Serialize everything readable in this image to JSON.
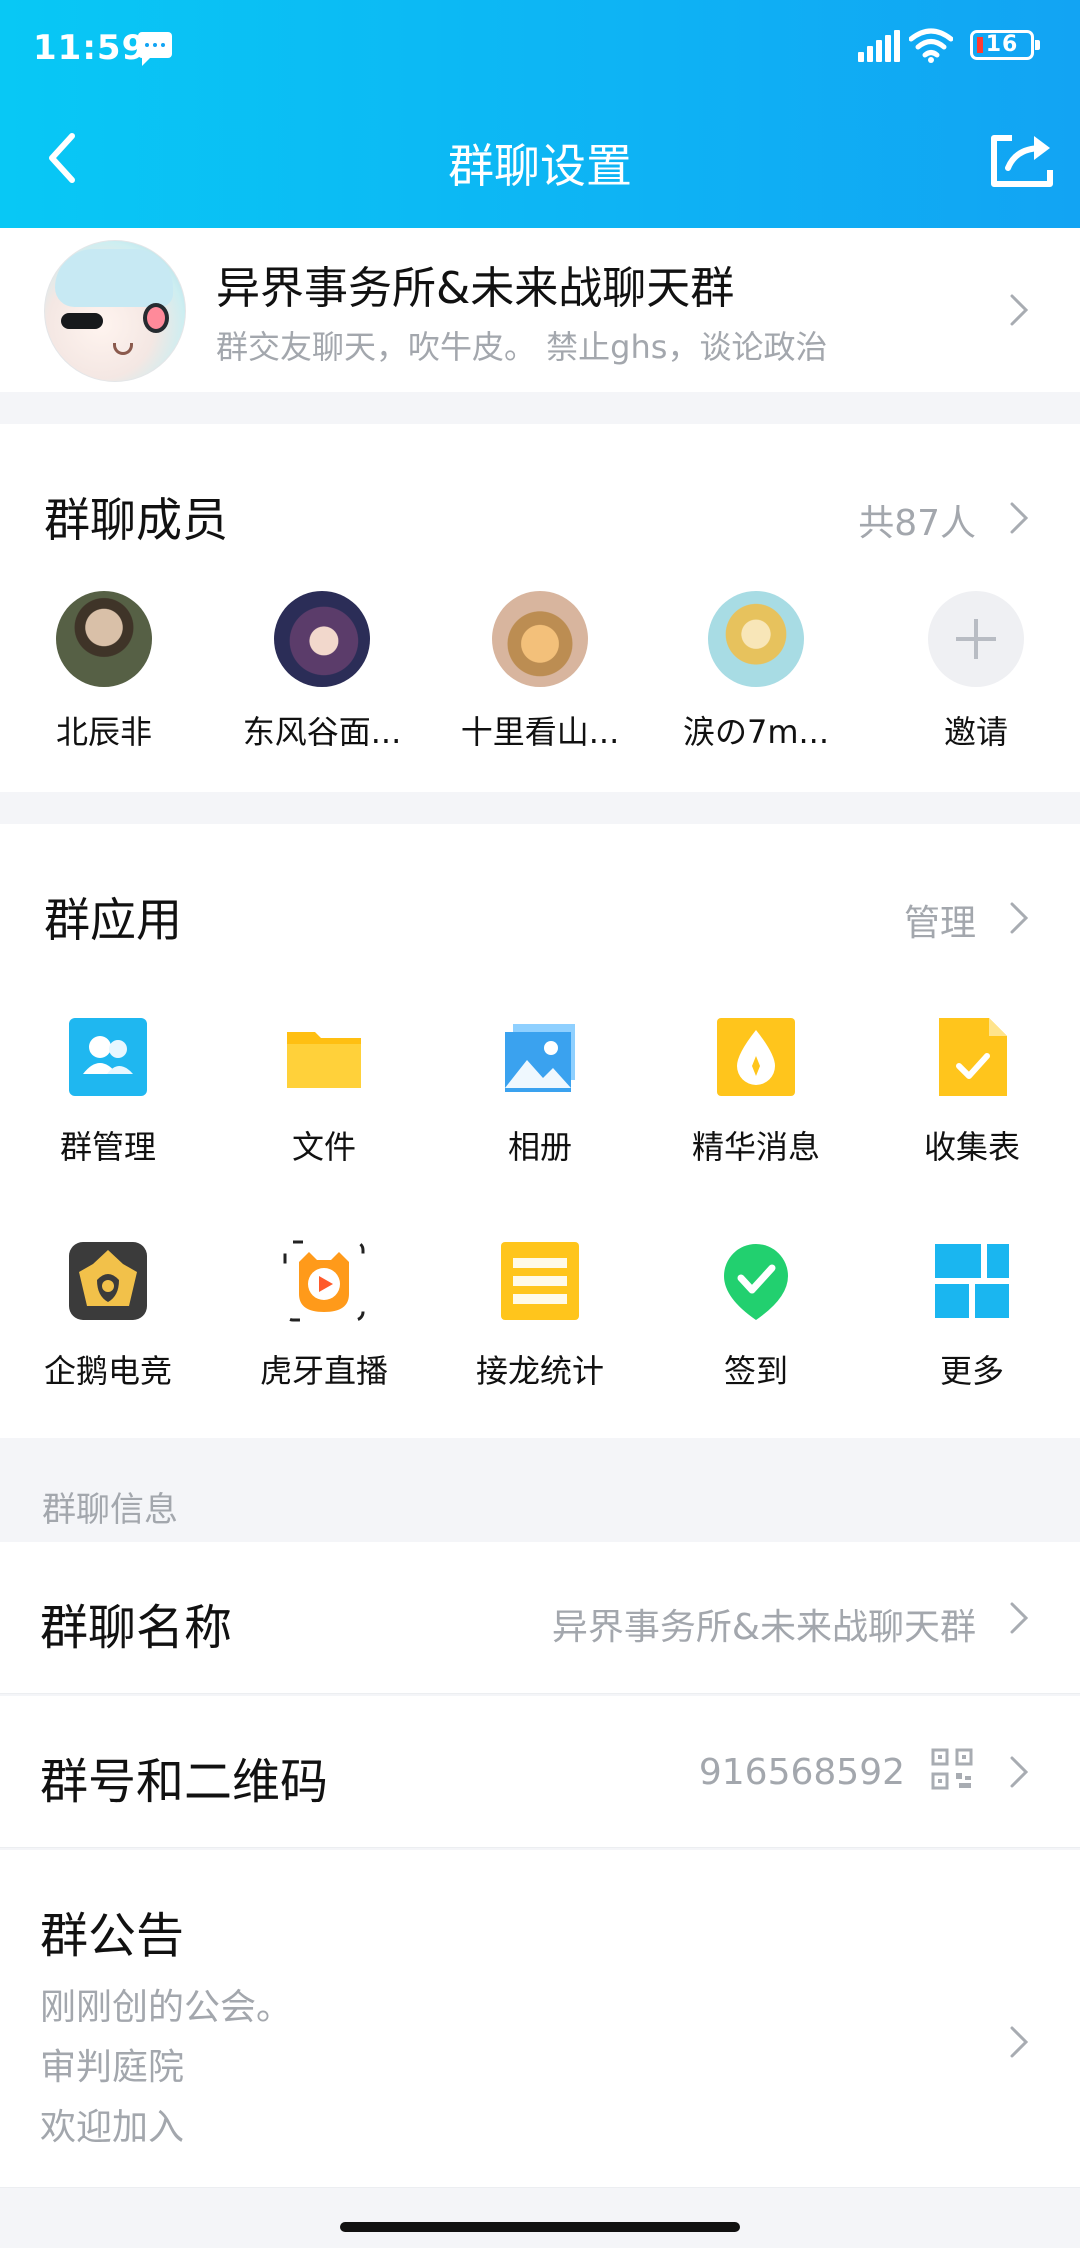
{
  "status_bar": {
    "time": "11:59",
    "battery": "16"
  },
  "nav": {
    "title": "群聊设置"
  },
  "group": {
    "name": "异界事务所&未来战聊天群",
    "description": "群交友聊天，吹牛皮。 禁止ghs，谈论政治"
  },
  "members": {
    "title": "群聊成员",
    "count": "共87人",
    "items": [
      {
        "name": "北辰非"
      },
      {
        "name": "东风谷面..."
      },
      {
        "name": "十里看山..."
      },
      {
        "name": "涙の7m..."
      },
      {
        "name": "邀请"
      }
    ]
  },
  "apps": {
    "title": "群应用",
    "manage": "管理",
    "items": [
      {
        "label": "群管理",
        "icon": "group-manage-icon",
        "color": "#24b7f2"
      },
      {
        "label": "文件",
        "icon": "folder-icon",
        "color": "#ffc51c"
      },
      {
        "label": "相册",
        "icon": "photo-album-icon",
        "color": "#35a6ef"
      },
      {
        "label": "精华消息",
        "icon": "essence-message-icon",
        "color": "#ffc51c"
      },
      {
        "label": "收集表",
        "icon": "collection-form-icon",
        "color": "#ffc51c"
      },
      {
        "label": "企鹅电竞",
        "icon": "penguin-esports-icon",
        "color": "#3a3a3a"
      },
      {
        "label": "虎牙直播",
        "icon": "huya-live-icon",
        "color": "#ff9b18"
      },
      {
        "label": "接龙统计",
        "icon": "chain-stats-icon",
        "color": "#ffc51c"
      },
      {
        "label": "签到",
        "icon": "checkin-icon",
        "color": "#25d374"
      },
      {
        "label": "更多",
        "icon": "more-apps-icon",
        "color": "#1ab6f0"
      }
    ]
  },
  "info": {
    "section_label": "群聊信息",
    "group_name_label": "群聊名称",
    "group_name_value": "异界事务所&未来战聊天群",
    "qrcode_label": "群号和二维码",
    "group_number": "916568592",
    "notice_label": "群公告",
    "notice_lines": [
      "刚刚创的公会。",
      "审判庭院",
      "欢迎加入"
    ]
  }
}
